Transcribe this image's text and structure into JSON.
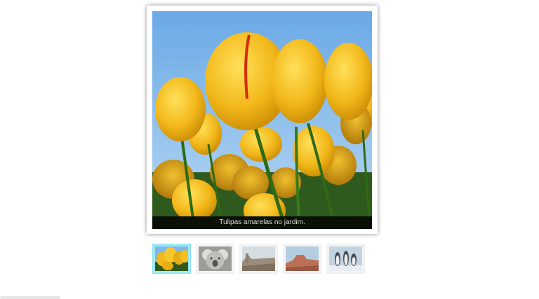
{
  "gallery": {
    "caption": "Tulipas amarelas no jardim.",
    "main_image": "yellow-tulips-photo",
    "thumbnails": [
      {
        "subject": "tulips-thumbnail",
        "active": true
      },
      {
        "subject": "koala-thumbnail",
        "active": false
      },
      {
        "subject": "desert-thumbnail",
        "active": false
      },
      {
        "subject": "canyon-thumbnail",
        "active": false
      },
      {
        "subject": "penguins-thumbnail",
        "active": false
      }
    ]
  },
  "colors": {
    "sky": "#7fb8ea",
    "tulip": "#f2c022",
    "active_thumb_border": "#9fe9f5",
    "caption_bar": "#000000"
  }
}
